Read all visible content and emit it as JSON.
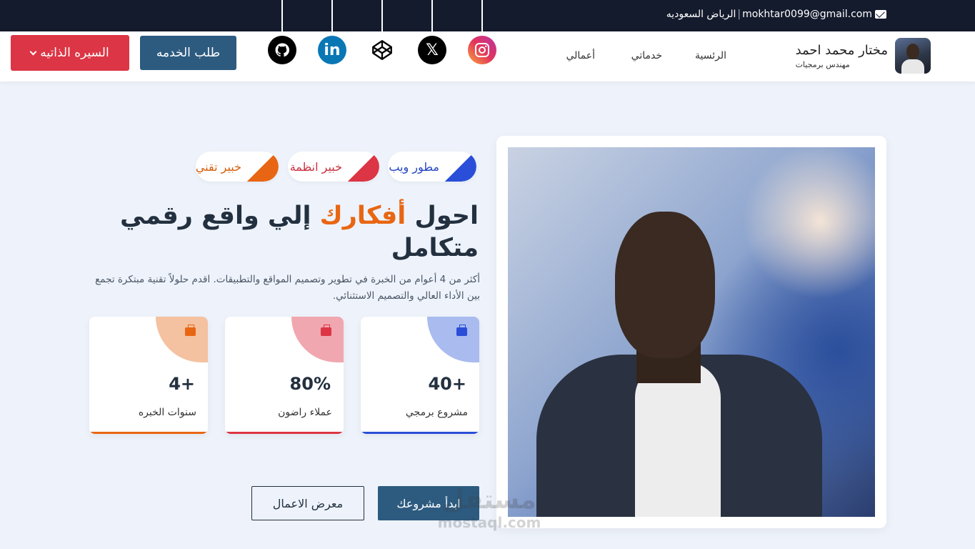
{
  "topbar": {
    "location": "الرياض السعوديه",
    "separator": "|",
    "email": "mokhtar0099@gmail.com"
  },
  "brand": {
    "name": "مختار محمد احمد",
    "role": "مهندس برمجيات"
  },
  "nav": {
    "home": "الرئسية",
    "services": "خدماتي",
    "works": "أعمالي"
  },
  "social": {
    "instagram": "instagram-icon",
    "x": "x-icon",
    "codepen": "codepen-icon",
    "linkedin": "linkedin-icon",
    "github": "github-icon",
    "x_glyph": "𝕏",
    "linkedin_glyph": "in"
  },
  "buttons": {
    "request_service": "طلب الخدمه",
    "cv": "السيره الذاتيه",
    "start_project": "ابدأ مشروعك",
    "portfolio": "معرض الاعمال"
  },
  "tags": {
    "web": "مطور ويب",
    "systems": "خبير انظمة",
    "tech": "خبير تقني"
  },
  "hero": {
    "headline_part1": "احول ",
    "headline_highlight": "أفكارك",
    "headline_part2": " إلي واقع رقمي متكامل",
    "description": "أكثر من 4 أعوام من الخبرة في تطوير وتصميم المواقع والتطبيقات. اقدم حلولاً تقنية مبتكرة تجمع بين الأداء العالي والتصميم الاستثنائي."
  },
  "stats": [
    {
      "value": "40+",
      "label": "مشروع برمجي"
    },
    {
      "value": "80%",
      "label": "عملاء راضون"
    },
    {
      "value": "4+",
      "label": "سنوات الخبره"
    }
  ],
  "watermark": {
    "arabic": "مستقل",
    "latin": "mostaql.com"
  },
  "colors": {
    "accent": "#e86613",
    "primary": "#2d5b80",
    "danger": "#dc3545",
    "blue": "#2a4ed8",
    "topbar": "#141b2d"
  }
}
